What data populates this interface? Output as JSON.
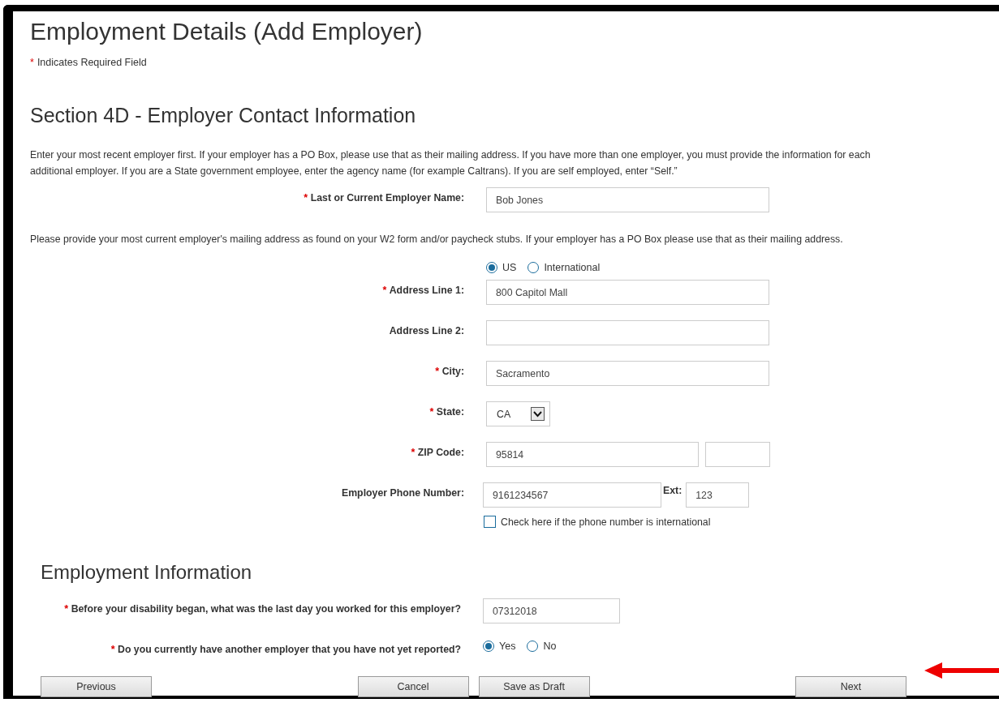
{
  "title": "Employment Details (Add Employer)",
  "required_note": {
    "marker": "*",
    "text": "Indicates Required Field"
  },
  "section": {
    "heading": "Section 4D - Employer Contact Information",
    "intro": "Enter your most recent employer first. If your employer has a PO Box, please use that as their mailing address. If you have more than one employer, you must provide the information for each additional employer. If you are a State government employee, enter the agency name (for example Caltrans). If you are self employed, enter “Self.”",
    "fields": [
      {
        "kind": "text",
        "required": true,
        "label": "Last or Current Employer Name:",
        "value": "Bob Jones"
      },
      {
        "kind": "note",
        "text": "Please provide your most current employer's mailing address as found on your W2 form and/or paycheck stubs. If your employer has a PO Box please use that as their mailing address."
      },
      {
        "kind": "radio",
        "options": [
          {
            "label": "US",
            "selected": true
          },
          {
            "label": "International",
            "selected": false
          }
        ]
      },
      {
        "kind": "text",
        "required": true,
        "label": "Address Line 1:",
        "value": "800 Capitol Mall"
      },
      {
        "kind": "text",
        "required": false,
        "label": "Address Line 2:"
      },
      {
        "kind": "text",
        "required": true,
        "label": "City:",
        "value": "Sacramento"
      },
      {
        "kind": "select",
        "required": true,
        "label": "State:",
        "value": "CA"
      },
      {
        "kind": "zip",
        "required": true,
        "label": "ZIP Code:",
        "value": "95814"
      },
      {
        "kind": "phone",
        "required": false,
        "label": "Employer Phone Number:",
        "value": "9161234567",
        "ext_label": "Ext:",
        "ext_value": "123"
      },
      {
        "kind": "checkbox",
        "label": "Check here if the phone number is international",
        "checked": false
      }
    ]
  },
  "employment": {
    "heading": "Employment Information",
    "fields": [
      {
        "kind": "text",
        "required": true,
        "label": "Before your disability began, what was the last day you worked for this employer?",
        "value": "07312018"
      },
      {
        "kind": "radio",
        "required": true,
        "label": "Do you currently have another employer that you have not yet reported?",
        "options": [
          {
            "label": "Yes",
            "selected": true
          },
          {
            "label": "No",
            "selected": false
          }
        ]
      }
    ]
  },
  "buttons": {
    "left": [
      "Previous"
    ],
    "middle": [
      "Cancel",
      "Save as Draft"
    ],
    "right": [
      "Next"
    ]
  }
}
